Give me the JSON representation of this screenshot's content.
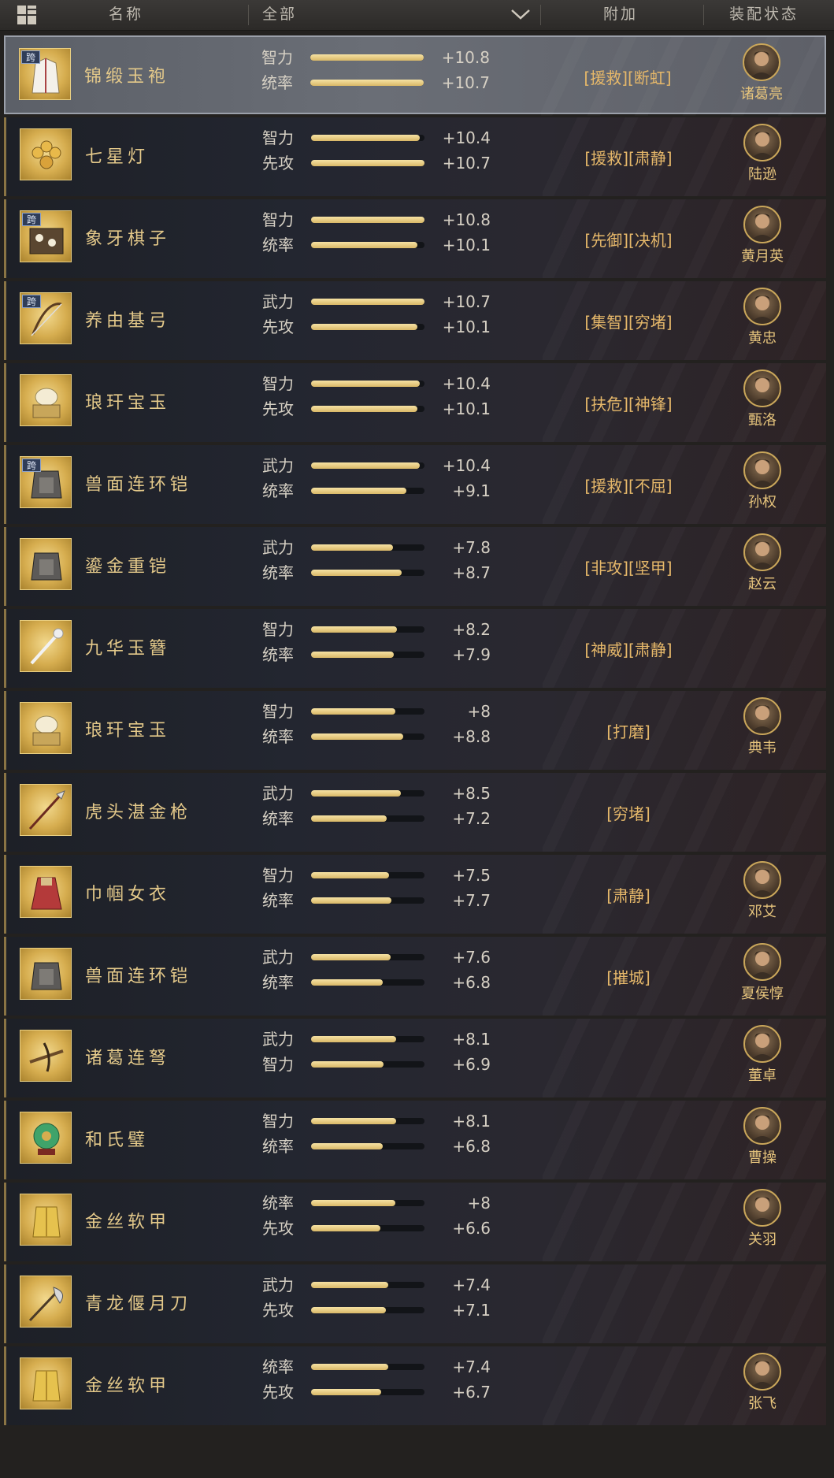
{
  "header": {
    "name_col": "名称",
    "filter_value": "全部",
    "extra_col": "附加",
    "status_col": "装配状态"
  },
  "rows": [
    {
      "name": "锦缎玉袍",
      "cross": "跨",
      "icon": "robe",
      "selected": true,
      "stats": [
        {
          "label": "智力",
          "value": "+10.8",
          "fill": 1.0
        },
        {
          "label": "统率",
          "value": "+10.7",
          "fill": 1.0
        }
      ],
      "extra": "[援救][断虹]",
      "hero": "诸葛亮"
    },
    {
      "name": "七星灯",
      "cross": "",
      "icon": "lamp",
      "stats": [
        {
          "label": "智力",
          "value": "+10.4",
          "fill": 0.96
        },
        {
          "label": "先攻",
          "value": "+10.7",
          "fill": 1.0
        }
      ],
      "extra": "[援救][肃静]",
      "hero": "陆逊"
    },
    {
      "name": "象牙棋子",
      "cross": "跨",
      "icon": "chess",
      "stats": [
        {
          "label": "智力",
          "value": "+10.8",
          "fill": 1.0
        },
        {
          "label": "统率",
          "value": "+10.1",
          "fill": 0.94
        }
      ],
      "extra": "[先御][决机]",
      "hero": "黄月英"
    },
    {
      "name": "养由基弓",
      "cross": "跨",
      "icon": "bow",
      "stats": [
        {
          "label": "武力",
          "value": "+10.7",
          "fill": 1.0
        },
        {
          "label": "先攻",
          "value": "+10.1",
          "fill": 0.94
        }
      ],
      "extra": "[集智][穷堵]",
      "hero": "黄忠"
    },
    {
      "name": "琅玕宝玉",
      "cross": "",
      "icon": "jade",
      "stats": [
        {
          "label": "智力",
          "value": "+10.4",
          "fill": 0.96
        },
        {
          "label": "先攻",
          "value": "+10.1",
          "fill": 0.94
        }
      ],
      "extra": "[扶危][神锋]",
      "hero": "甄洛"
    },
    {
      "name": "兽面连环铠",
      "cross": "跨",
      "icon": "armor",
      "stats": [
        {
          "label": "武力",
          "value": "+10.4",
          "fill": 0.96
        },
        {
          "label": "统率",
          "value": "+9.1",
          "fill": 0.84
        }
      ],
      "extra": "[援救][不屈]",
      "hero": "孙权"
    },
    {
      "name": "鎏金重铠",
      "cross": "",
      "icon": "armor",
      "stats": [
        {
          "label": "武力",
          "value": "+7.8",
          "fill": 0.72
        },
        {
          "label": "统率",
          "value": "+8.7",
          "fill": 0.8
        }
      ],
      "extra": "[非攻][坚甲]",
      "hero": "赵云"
    },
    {
      "name": "九华玉簪",
      "cross": "",
      "icon": "hairpin",
      "stats": [
        {
          "label": "智力",
          "value": "+8.2",
          "fill": 0.76
        },
        {
          "label": "统率",
          "value": "+7.9",
          "fill": 0.73
        }
      ],
      "extra": "[神威][肃静]",
      "hero": ""
    },
    {
      "name": "琅玕宝玉",
      "cross": "",
      "icon": "jade",
      "stats": [
        {
          "label": "智力",
          "value": "+8",
          "fill": 0.74
        },
        {
          "label": "统率",
          "value": "+8.8",
          "fill": 0.81
        }
      ],
      "extra": "[打磨]",
      "hero": "典韦"
    },
    {
      "name": "虎头湛金枪",
      "cross": "",
      "icon": "spear",
      "stats": [
        {
          "label": "武力",
          "value": "+8.5",
          "fill": 0.79
        },
        {
          "label": "统率",
          "value": "+7.2",
          "fill": 0.67
        }
      ],
      "extra": "[穷堵]",
      "hero": ""
    },
    {
      "name": "巾帼女衣",
      "cross": "",
      "icon": "dress",
      "stats": [
        {
          "label": "智力",
          "value": "+7.5",
          "fill": 0.69
        },
        {
          "label": "统率",
          "value": "+7.7",
          "fill": 0.71
        }
      ],
      "extra": "[肃静]",
      "hero": "邓艾"
    },
    {
      "name": "兽面连环铠",
      "cross": "",
      "icon": "armor",
      "stats": [
        {
          "label": "武力",
          "value": "+7.6",
          "fill": 0.7
        },
        {
          "label": "统率",
          "value": "+6.8",
          "fill": 0.63
        }
      ],
      "extra": "[摧城]",
      "hero": "夏侯惇"
    },
    {
      "name": "诸葛连弩",
      "cross": "",
      "icon": "crossbow",
      "stats": [
        {
          "label": "武力",
          "value": "+8.1",
          "fill": 0.75
        },
        {
          "label": "智力",
          "value": "+6.9",
          "fill": 0.64
        }
      ],
      "extra": "",
      "hero": "董卓"
    },
    {
      "name": "和氏璧",
      "cross": "",
      "icon": "bi",
      "stats": [
        {
          "label": "智力",
          "value": "+8.1",
          "fill": 0.75
        },
        {
          "label": "统率",
          "value": "+6.8",
          "fill": 0.63
        }
      ],
      "extra": "",
      "hero": "曹操"
    },
    {
      "name": "金丝软甲",
      "cross": "",
      "icon": "vest",
      "stats": [
        {
          "label": "统率",
          "value": "+8",
          "fill": 0.74
        },
        {
          "label": "先攻",
          "value": "+6.6",
          "fill": 0.61
        }
      ],
      "extra": "",
      "hero": "关羽"
    },
    {
      "name": "青龙偃月刀",
      "cross": "",
      "icon": "glaive",
      "stats": [
        {
          "label": "武力",
          "value": "+7.4",
          "fill": 0.68
        },
        {
          "label": "先攻",
          "value": "+7.1",
          "fill": 0.66
        }
      ],
      "extra": "",
      "hero": ""
    },
    {
      "name": "金丝软甲",
      "cross": "",
      "icon": "vest",
      "stats": [
        {
          "label": "统率",
          "value": "+7.4",
          "fill": 0.68
        },
        {
          "label": "先攻",
          "value": "+6.7",
          "fill": 0.62
        }
      ],
      "extra": "",
      "hero": "张飞"
    }
  ]
}
